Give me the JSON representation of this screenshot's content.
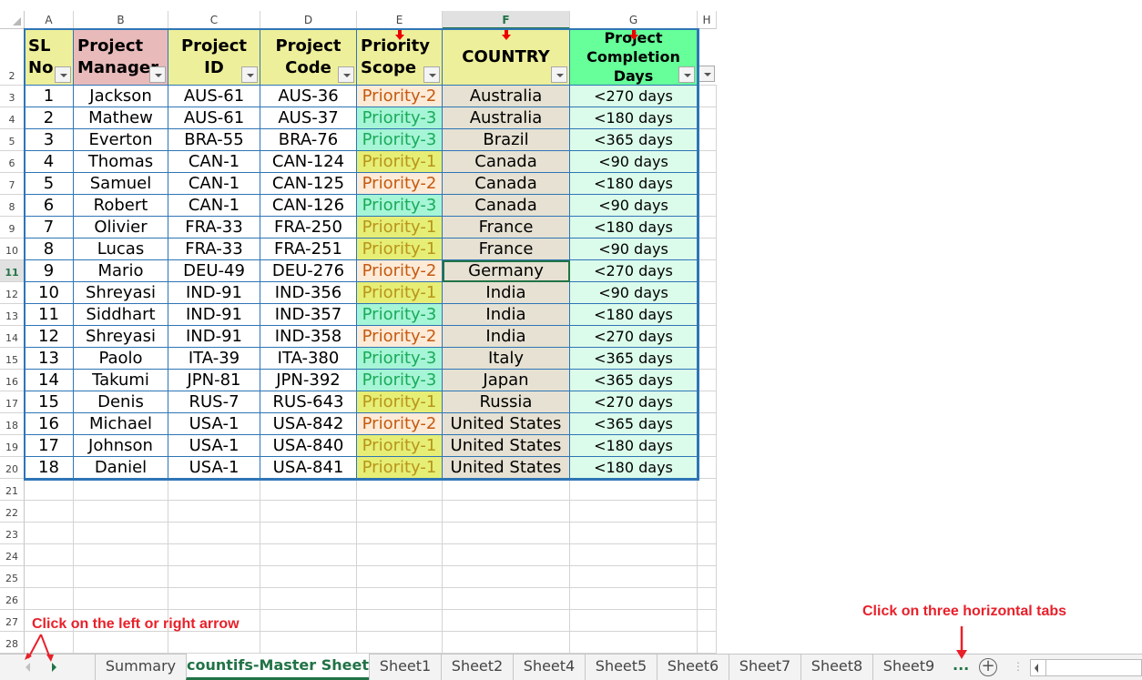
{
  "columns": [
    "A",
    "B",
    "C",
    "D",
    "E",
    "F",
    "G",
    "H"
  ],
  "selected_column": "F",
  "selected_row": 11,
  "headers": [
    {
      "text": "SL No",
      "filter": true
    },
    {
      "text": "Project Manager",
      "filter": true
    },
    {
      "text": "Project ID",
      "filter": true
    },
    {
      "text": "Project Code",
      "filter": true
    },
    {
      "text": "Priority Scope",
      "filter": true
    },
    {
      "text": "COUNTRY",
      "filter": true
    },
    {
      "text": "Project Completion Days",
      "filter": true
    }
  ],
  "header_colors": [
    "#eeef9a",
    "#e9baba",
    "#eeef9a",
    "#eeef9a",
    "#eeef9a",
    "#eeef9a",
    "#66ff99"
  ],
  "priority_styles": {
    "Priority-1": {
      "bg": "#e6ee75",
      "fg": "#b8951a"
    },
    "Priority-2": {
      "bg": "#fdebd8",
      "fg": "#c55a11"
    },
    "Priority-3": {
      "bg": "#a6f5d6",
      "fg": "#1aab5a"
    }
  },
  "country_bg": "#e6e1d2",
  "days_bg": "#dcfceb",
  "rows": [
    [
      "1",
      "Jackson",
      "AUS-61",
      "AUS-36",
      "Priority-2",
      "Australia",
      "<270 days"
    ],
    [
      "2",
      "Mathew",
      "AUS-61",
      "AUS-37",
      "Priority-3",
      "Australia",
      "<180 days"
    ],
    [
      "3",
      "Everton",
      "BRA-55",
      "BRA-76",
      "Priority-3",
      "Brazil",
      "<365 days"
    ],
    [
      "4",
      "Thomas",
      "CAN-1",
      "CAN-124",
      "Priority-1",
      "Canada",
      "<90 days"
    ],
    [
      "5",
      "Samuel",
      "CAN-1",
      "CAN-125",
      "Priority-2",
      "Canada",
      "<180 days"
    ],
    [
      "6",
      "Robert",
      "CAN-1",
      "CAN-126",
      "Priority-3",
      "Canada",
      "<90 days"
    ],
    [
      "7",
      "Olivier",
      "FRA-33",
      "FRA-250",
      "Priority-1",
      "France",
      "<180 days"
    ],
    [
      "8",
      "Lucas",
      "FRA-33",
      "FRA-251",
      "Priority-1",
      "France",
      "<90 days"
    ],
    [
      "9",
      "Mario",
      "DEU-49",
      "DEU-276",
      "Priority-2",
      "Germany",
      "<270 days"
    ],
    [
      "10",
      "Shreyasi",
      "IND-91",
      "IND-356",
      "Priority-1",
      "India",
      "<90 days"
    ],
    [
      "11",
      "Siddhart",
      "IND-91",
      "IND-357",
      "Priority-3",
      "India",
      "<180 days"
    ],
    [
      "12",
      "Shreyasi",
      "IND-91",
      "IND-358",
      "Priority-2",
      "India",
      "<270 days"
    ],
    [
      "13",
      "Paolo",
      "ITA-39",
      "ITA-380",
      "Priority-3",
      "Italy",
      "<365 days"
    ],
    [
      "14",
      "Takumi",
      "JPN-81",
      "JPN-392",
      "Priority-3",
      "Japan",
      "<365 days"
    ],
    [
      "15",
      "Denis",
      "RUS-7",
      "RUS-643",
      "Priority-1",
      "Russia",
      "<270 days"
    ],
    [
      "16",
      "Michael",
      "USA-1",
      "USA-842",
      "Priority-2",
      "United States",
      "<365 days"
    ],
    [
      "17",
      "Johnson",
      "USA-1",
      "USA-840",
      "Priority-1",
      "United States",
      "<180 days"
    ],
    [
      "18",
      "Daniel",
      "USA-1",
      "USA-841",
      "Priority-1",
      "United States",
      "<180 days"
    ]
  ],
  "empty_rows": [
    21,
    22,
    23,
    24,
    25,
    26,
    27,
    28
  ],
  "sheet_tabs": [
    "Summary",
    "countifs-Master Sheet",
    "Sheet1",
    "Sheet2",
    "Sheet4",
    "Sheet5",
    "Sheet6",
    "Sheet7",
    "Sheet8",
    "Sheet9"
  ],
  "active_tab": "countifs-Master Sheet",
  "more_tabs": "...",
  "annotations": {
    "arrows_note": "Click on the left or right arrow",
    "tabs_note": "Click on three horizontal tabs"
  }
}
